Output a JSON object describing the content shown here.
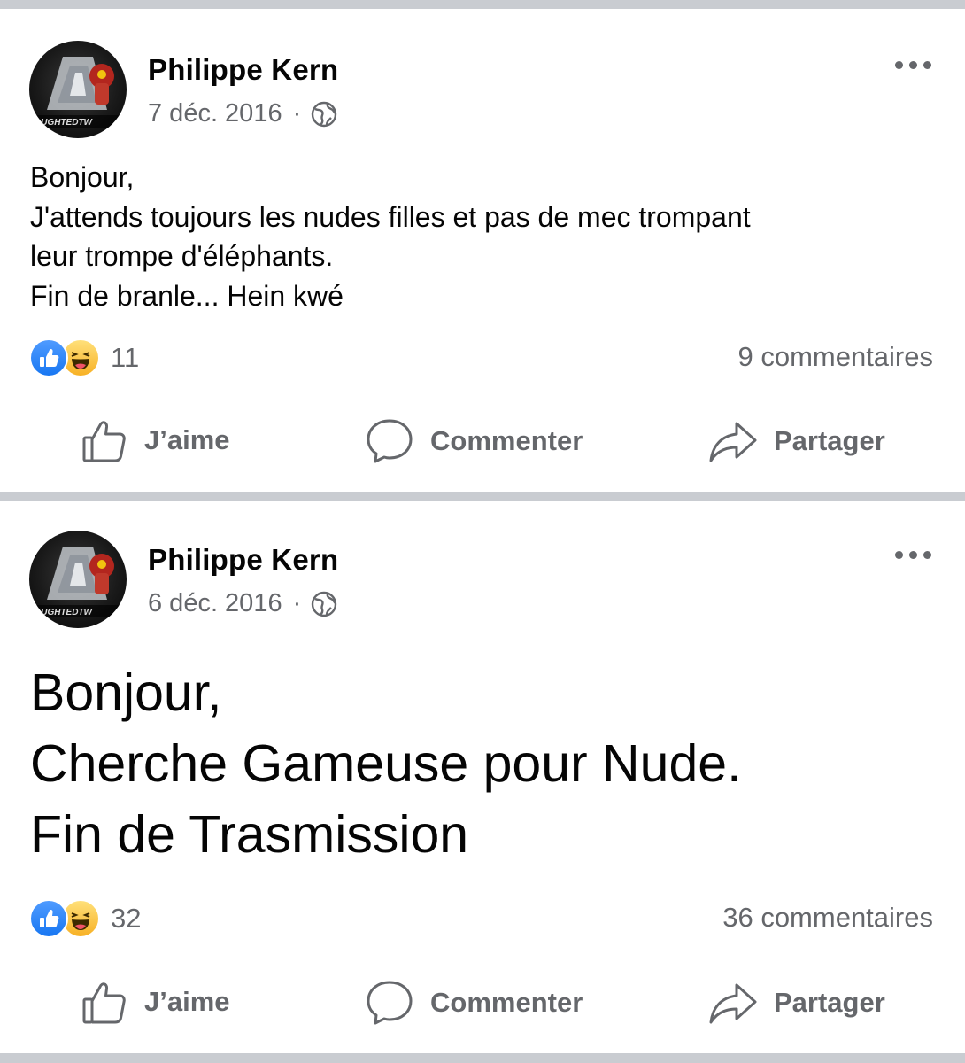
{
  "posts": [
    {
      "author": "Philippe Kern",
      "date": "7 déc. 2016",
      "dot": "·",
      "avatar_text": "AUGHTEDTW",
      "body": [
        "Bonjour,",
        "J'attends toujours les nudes filles et pas de mec trompant",
        "leur trompe d'éléphants.",
        "Fin de branle... Hein kwé"
      ],
      "reaction_count": "11",
      "comments": "9 commentaires"
    },
    {
      "author": "Philippe Kern",
      "date": "6 déc. 2016",
      "dot": "·",
      "avatar_text": "AUGHTEDTW",
      "body": [
        "Bonjour,",
        "Cherche Gameuse pour Nude.",
        "Fin de Trasmission"
      ],
      "reaction_count": "32",
      "comments": "36 commentaires"
    }
  ],
  "actions": {
    "like": "J’aime",
    "comment": "Commenter",
    "share": "Partager"
  },
  "icons": {
    "reactions": [
      "like-reaction-icon",
      "haha-reaction-icon"
    ],
    "privacy": "globe-icon",
    "more": "more-options-icon"
  },
  "colors": {
    "like_blue": "#1877f2",
    "secondary_text": "#65676b",
    "separator": "#c9ccd1"
  }
}
